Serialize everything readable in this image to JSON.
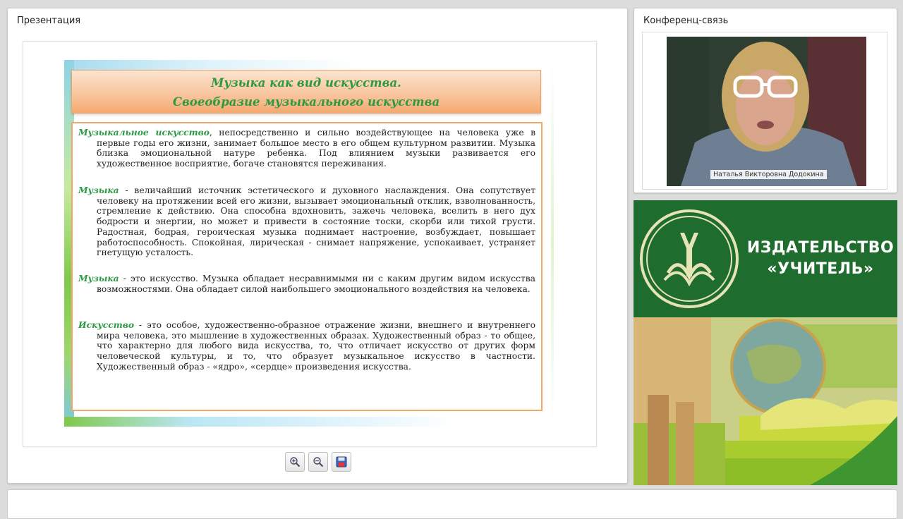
{
  "presentation": {
    "panel_title": "Презентация",
    "slide": {
      "title_line1": "Музыка как вид искусства.",
      "title_line2": "Своеобразие музыкального искусства",
      "paragraphs": [
        {
          "term": "Музыкальное искусство",
          "text": ", непосредственно и сильно воздействующее на человека уже в первые годы его жизни, занимает большое место в его общем культурном развитии. Музыка близка эмоциональной натуре ребенка. Под влиянием музыки развивается его художественное восприятие, богаче становятся переживания."
        },
        {
          "term": "Музыка",
          "text": " - величайший источник эстетического и духовного наслаждения. Она сопутствует человеку на протяжении всей его жизни, вызывает эмоциональный отклик, взволнованность, стремление к действию. Она способна вдохновить, зажечь человека, вселить в него дух бодрости и энергии, но может и привести в состояние тоски, скорби или тихой грусти. Радостная, бодрая, героическая музыка поднимает настроение, возбуждает, повышает работоспособность. Спокойная, лирическая - снимает напряжение, успокаивает, устраняет гнетущую усталость."
        },
        {
          "term": "Музыка",
          "text": " - это искусство. Музыка обладает несравнимыми ни с каким другим видом искусства возможностями. Она обладает силой наибольшего эмоционального воздействия на человека."
        },
        {
          "term": "Искусство",
          "text": " - это особое, художественно-образное отражение жизни, внешнего и внутреннего мира человека, это мышление в художественных образах. Художественный образ - то общее, что характерно для любого вида искусства, то, что отличает искусство от других форм человеческой культуры, и то, что образует музыкальное искусство в частности. Художественный образ - «ядро», «сердце» произведения искусства."
        }
      ]
    },
    "toolbar": {
      "zoom_in_icon": "zoom-in-icon",
      "zoom_out_icon": "zoom-out-icon",
      "save_icon": "save-icon"
    }
  },
  "conference": {
    "panel_title": "Конференц-связь",
    "participant_name": "Наталья Викторовна Додокина"
  },
  "publisher_ad": {
    "line1": "ИЗДАТЕЛЬСТВО",
    "line2": "«УЧИТЕЛЬ»",
    "brand_color": "#1f6d2e"
  }
}
